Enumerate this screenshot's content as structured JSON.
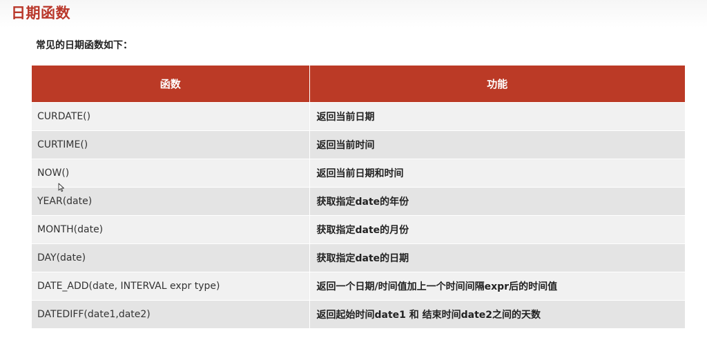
{
  "slide": {
    "title": "日期函数",
    "subtitle": "常见的日期函数如下："
  },
  "table": {
    "headers": [
      "函数",
      "功能"
    ],
    "rows": [
      {
        "func": "CURDATE()",
        "desc": "返回当前日期"
      },
      {
        "func": "CURTIME()",
        "desc": "返回当前时间"
      },
      {
        "func": "NOW()",
        "desc": "返回当前日期和时间"
      },
      {
        "func": "YEAR(date)",
        "desc": "获取指定date的年份"
      },
      {
        "func": "MONTH(date)",
        "desc": "获取指定date的月份"
      },
      {
        "func": "DAY(date)",
        "desc": "获取指定date的日期"
      },
      {
        "func": "DATE_ADD(date, INTERVAL expr  type)",
        "desc": "返回一个日期/时间值加上一个时间间隔expr后的时间值"
      },
      {
        "func": "DATEDIFF(date1,date2)",
        "desc": "返回起始时间date1 和 结束时间date2之间的天数"
      }
    ]
  },
  "colors": {
    "title": "#b9372a",
    "header_bg": "#bb3a26",
    "row_light": "#f1f1f1",
    "row_dark": "#e4e4e4"
  },
  "icons": {
    "cursor": "mouse-pointer-icon"
  }
}
